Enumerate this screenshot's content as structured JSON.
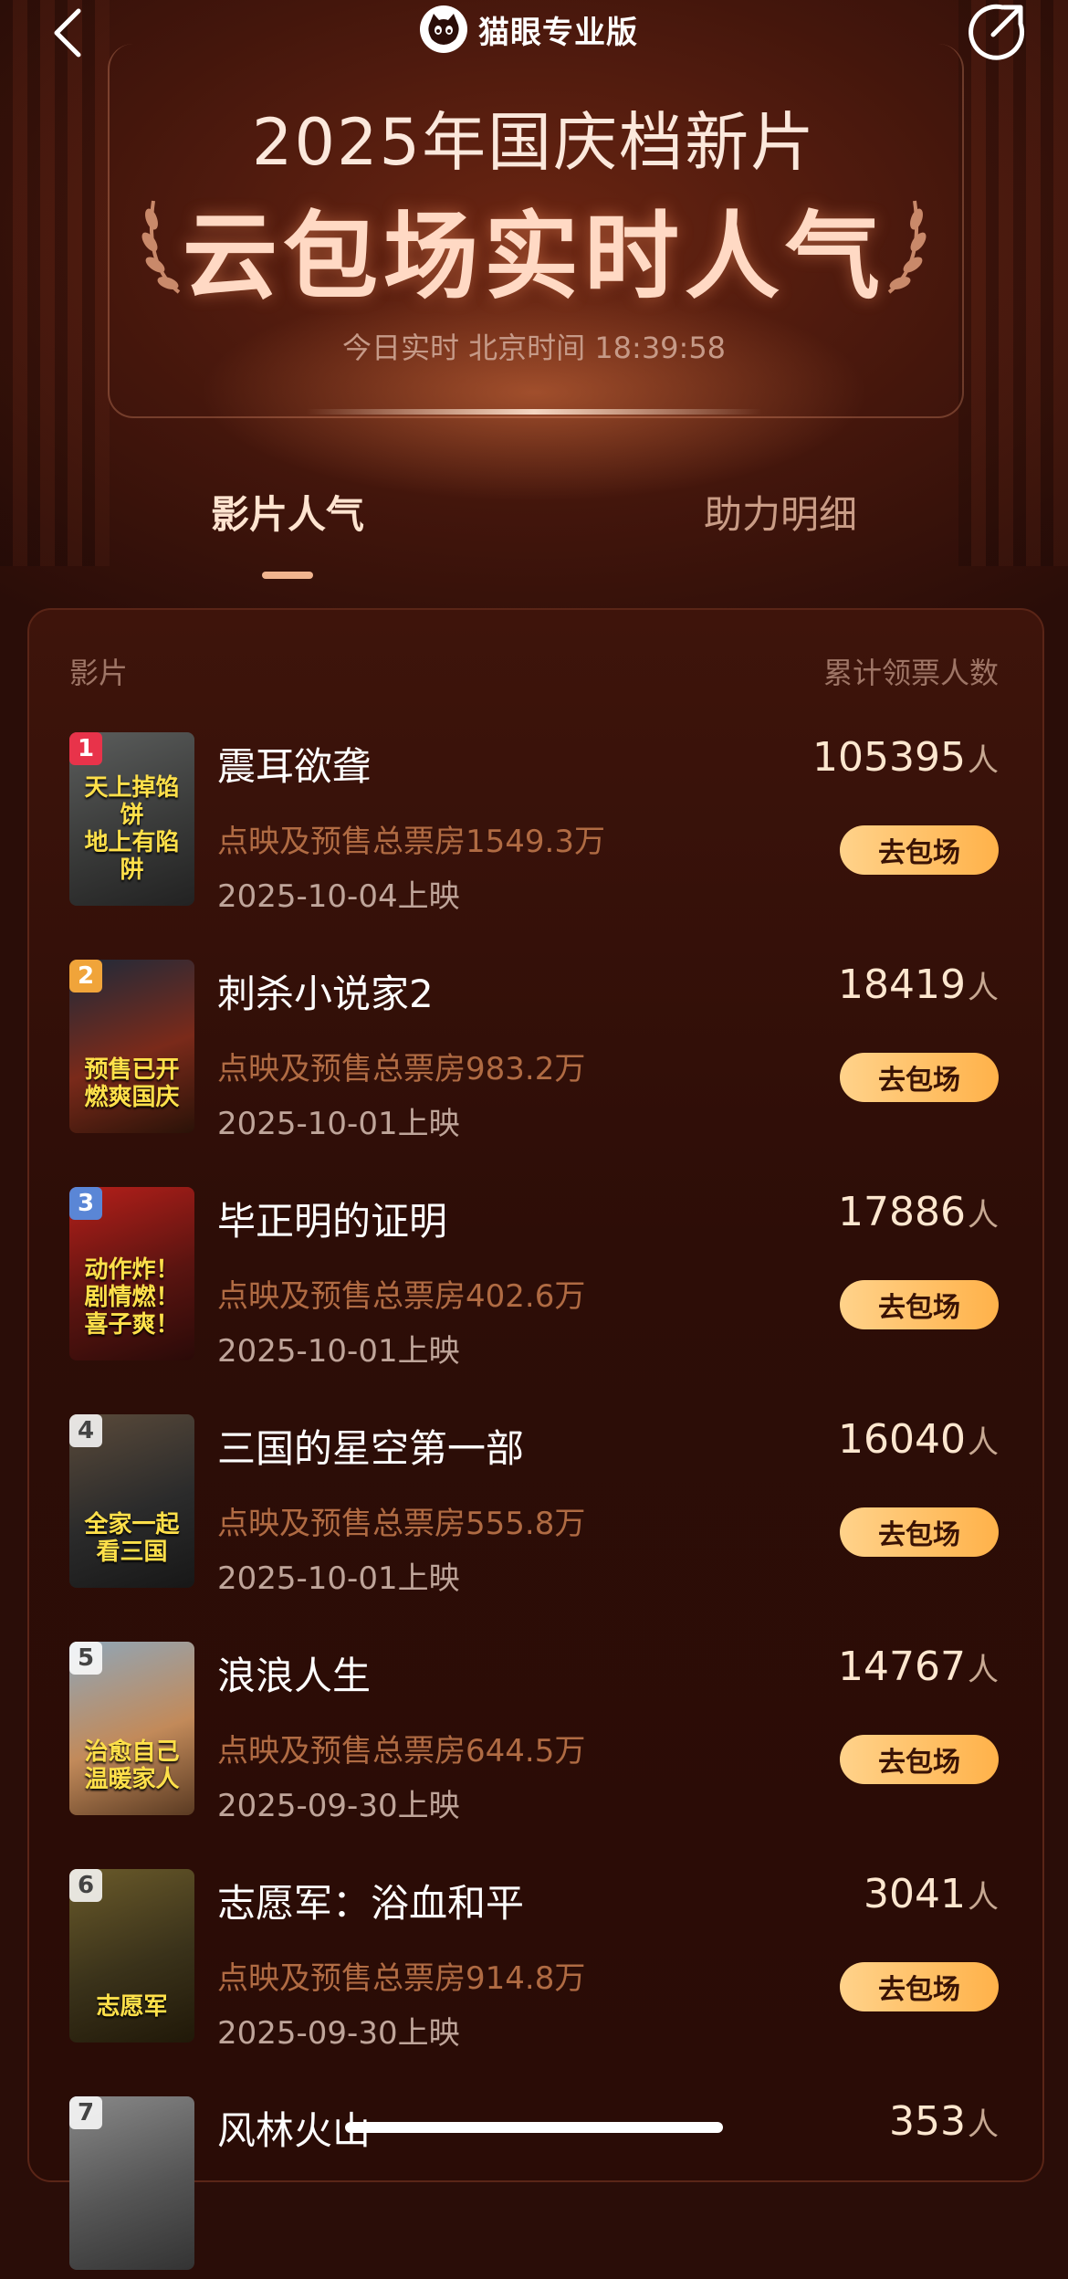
{
  "header": {
    "brand": "猫眼专业版",
    "title_line1": "2025年国庆档新片",
    "title_line2": "云包场实时人气",
    "time_prefix": "今日实时 北京时间",
    "time_value": "18:39:58"
  },
  "tabs": [
    {
      "label": "影片人气",
      "active": true
    },
    {
      "label": "助力明细",
      "active": false
    }
  ],
  "table": {
    "col_left": "影片",
    "col_right": "累计领票人数"
  },
  "count_unit": "人",
  "button_label": "去包场",
  "colors": {
    "accent": "#ffb24a",
    "box_office_text": "#b06b43",
    "rank1": "#e8334a",
    "rank2": "#f0a43a",
    "rank3": "#5a86d6",
    "rank_other": "#8a8a8a"
  },
  "movies": [
    {
      "rank": "1",
      "title": "震耳欲聋",
      "box_office": "点映及预售总票房1549.3万",
      "release": "2025-10-04上映",
      "count": "105395",
      "poster_text": "天上掉馅饼\n地上有陷阱"
    },
    {
      "rank": "2",
      "title": "刺杀小说家2",
      "box_office": "点映及预售总票房983.2万",
      "release": "2025-10-01上映",
      "count": "18419",
      "poster_text": "预售已开  燃爽国庆"
    },
    {
      "rank": "3",
      "title": "毕正明的证明",
      "box_office": "点映及预售总票房402.6万",
      "release": "2025-10-01上映",
      "count": "17886",
      "poster_text": "动作炸！剧情燃！喜子爽！"
    },
    {
      "rank": "4",
      "title": "三国的星空第一部",
      "box_office": "点映及预售总票房555.8万",
      "release": "2025-10-01上映",
      "count": "16040",
      "poster_text": "全家一起\n看三国"
    },
    {
      "rank": "5",
      "title": "浪浪人生",
      "box_office": "点映及预售总票房644.5万",
      "release": "2025-09-30上映",
      "count": "14767",
      "poster_text": "治愈自己\n温暖家人"
    },
    {
      "rank": "6",
      "title": "志愿军：浴血和平",
      "box_office": "点映及预售总票房914.8万",
      "release": "2025-09-30上映",
      "count": "3041",
      "poster_text": "志愿军"
    },
    {
      "rank": "7",
      "title": "风林火山",
      "box_office": "",
      "release": "",
      "count": "353",
      "poster_text": ""
    }
  ]
}
